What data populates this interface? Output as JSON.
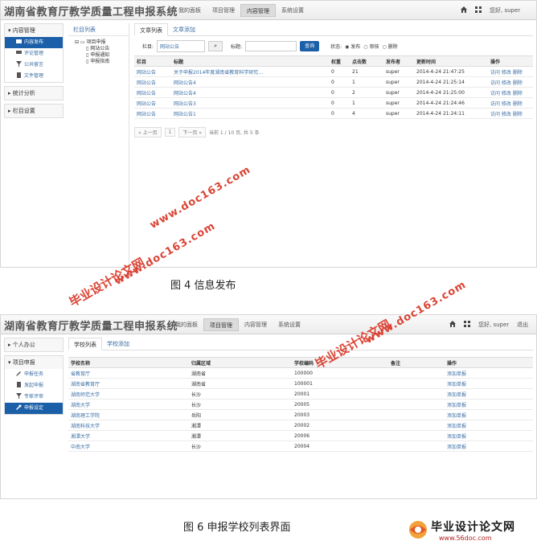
{
  "brand": "湖南省教育厅教学质量工程申报系统",
  "nav": [
    "我的面板",
    "项目管理",
    "内容管理",
    "系统设置"
  ],
  "greeting": "您好, super",
  "logout": "退出",
  "screen1": {
    "nav_active": 2,
    "sidebar": [
      {
        "title": "内容管理",
        "items": [
          {
            "label": "内容发布",
            "icon": "folder-icon",
            "active": true
          },
          {
            "label": "评论管理",
            "icon": "comment-icon",
            "active": false
          },
          {
            "label": "公共留言",
            "icon": "filter-icon",
            "active": false
          },
          {
            "label": "文件管理",
            "icon": "file-icon",
            "active": false
          }
        ]
      },
      {
        "title": "统计分析",
        "items": []
      },
      {
        "title": "栏目设置",
        "items": []
      }
    ],
    "tree_title": "栏目列表",
    "tree_root": "项目申报",
    "tree_children": [
      "网站公告",
      "申报通知",
      "申报指南"
    ],
    "tabs": [
      "文章列表",
      "文章添加"
    ],
    "filter": {
      "column_label": "栏目:",
      "column_value": "网站公告",
      "title_label": "标题:",
      "query_button": "查询",
      "status_label": "状态:",
      "status_options": [
        "发布",
        "审核",
        "删除"
      ]
    },
    "table_headers": [
      "栏目",
      "标题",
      "权重",
      "点击数",
      "发布者",
      "更新时间",
      "操作"
    ],
    "rows": [
      [
        "网站公告",
        "关于申报2014年度湖南省教育科学研究...",
        "0",
        "21",
        "super",
        "2014-4-24 21:47:25",
        "访问 修改 删除"
      ],
      [
        "网站公告",
        "网站公告4",
        "0",
        "1",
        "super",
        "2014-4-24 21:25:14",
        "访问 修改 删除"
      ],
      [
        "网站公告",
        "网站公告4",
        "0",
        "2",
        "super",
        "2014-4-24 21:25:00",
        "访问 修改 删除"
      ],
      [
        "网站公告",
        "网站公告3",
        "0",
        "1",
        "super",
        "2014-4-24 21:24:46",
        "访问 修改 删除"
      ],
      [
        "网站公告",
        "网站公告1",
        "0",
        "4",
        "super",
        "2014-4-24 21:24:11",
        "访问 修改 删除"
      ]
    ],
    "pager": {
      "prev": "« 上一页",
      "page": "1",
      "next": "下一页 »",
      "info": "当前 1 / 10 页, 共 5 条"
    },
    "caption": "图 4 信息发布"
  },
  "screen2": {
    "nav_active": 1,
    "sidebar": [
      {
        "title": "个人办公",
        "items": []
      },
      {
        "title": "项目申报",
        "items": [
          {
            "label": "申报任务",
            "icon": "pencil-icon",
            "active": false
          },
          {
            "label": "发起申报",
            "icon": "file-icon",
            "active": false
          },
          {
            "label": "专家评审",
            "icon": "filter-icon",
            "active": false
          },
          {
            "label": "申报设定",
            "icon": "wrench-icon",
            "active": true
          }
        ]
      }
    ],
    "tabs": [
      "学校列表",
      "学校添加"
    ],
    "table_headers": [
      "学校名称",
      "归属区域",
      "学校编码",
      "备注",
      "操作"
    ],
    "rows": [
      [
        "省教育厅",
        "湖南省",
        "100000",
        "",
        "添加单报"
      ],
      [
        "湖南省教育厅",
        "湖南省",
        "100001",
        "",
        "添加单报"
      ],
      [
        "湖南师范大学",
        "长沙",
        "20001",
        "",
        "添加单报"
      ],
      [
        "湖南大学",
        "长沙",
        "20005",
        "",
        "添加单报"
      ],
      [
        "湖南理工学院",
        "岳阳",
        "20003",
        "",
        "添加单报"
      ],
      [
        "湖南科技大学",
        "湘潭",
        "20002",
        "",
        "添加单报"
      ],
      [
        "湘潭大学",
        "湘潭",
        "20006",
        "",
        "添加单报"
      ],
      [
        "中南大学",
        "长沙",
        "20004",
        "",
        "添加单报"
      ]
    ],
    "caption": "图 6 申报学校列表界面"
  },
  "watermark": {
    "site": "毕业设计论文网",
    "url": "www.doc163.com",
    "url2": "www.56doc.com"
  },
  "colors": {
    "accent": "#1b5fa8",
    "link": "#3a6ea5",
    "watermark": "#d93a2b"
  }
}
